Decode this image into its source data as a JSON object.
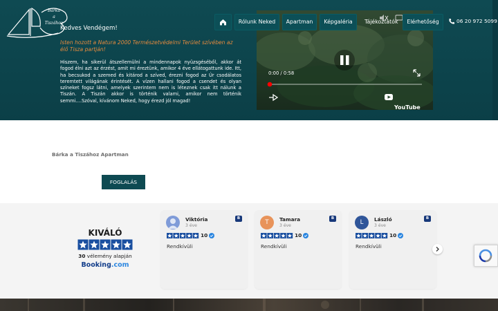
{
  "logo": {
    "line1": "Bárka",
    "line2": "a",
    "line3": "Tiszához"
  },
  "nav": {
    "home_icon": "home-icon",
    "items": [
      "Rólunk Neked",
      "Apartman",
      "Képgaléria",
      "Tájékoztatók",
      "Elérhetőség"
    ],
    "phone": "06 20 972 5099",
    "phone_icon": "phone-icon"
  },
  "hero": {
    "greeting": "Kedves Vendégem!",
    "tagline": "Isten hozott a Natura 2000 Természetvédelmi Terület szívében az élő Tisza partján!",
    "intro": "Hiszem, ha sikerül átszellemülni a mindennapok nyüzsgéséből, akkor át fogod élni azt az érzést, amit mi éreztünk, amikor 4 éve ellátogattunk ide. Itt, ha becsukod a szemed és kitárod a szíved, érezni fogod az Úr csodálatos teremtett világának érintését. A vízen hallani fogod a csendet és olyan színeket fogsz látni, amelyek szerintem nem is léteznek csak itt nálunk a Tiszán. A Tiszán akkor is történik valami, amikor nem történik semmi....Szóval, kívánom Neked, hogy érezd jól magad!"
  },
  "video": {
    "time": "0:00 / 0:58",
    "progress_fraction": 0.0,
    "platform": "YouTube",
    "icons": [
      "pause-icon",
      "fullscreen-icon",
      "share-icon",
      "mute-icon",
      "captions-icon"
    ]
  },
  "apartment": {
    "name": "Bárka a Tiszához Apartman",
    "book_label": "FOGLALÁS"
  },
  "reviews": {
    "rating_word": "KIVÁLÓ",
    "stars": 5,
    "count_number": "30",
    "count_suffix": "vélemény alapján",
    "provider_main": "Booking",
    "provider_tld": ".com",
    "items": [
      {
        "initial": "",
        "name": "Viktória",
        "time": "3 éve",
        "score": "10",
        "text": "Rendkívüli",
        "color": "#7f9bd8"
      },
      {
        "initial": "T",
        "name": "Tamara",
        "time": "3 éve",
        "score": "10",
        "text": "Rendkívüli",
        "color": "#e8935a"
      },
      {
        "initial": "L",
        "name": "László",
        "time": "3 éve",
        "score": "10",
        "text": "Rendkívüli",
        "color": "#2f5599"
      }
    ],
    "badge_letter": "B",
    "next_icon": "chevron-right-icon"
  },
  "colors": {
    "hero_bg": "#0f4a52",
    "accent_orange": "#e58a3e",
    "button_bg": "#0e4a52",
    "booking_blue": "#123d8a",
    "star_blue": "#1a4fa0"
  }
}
